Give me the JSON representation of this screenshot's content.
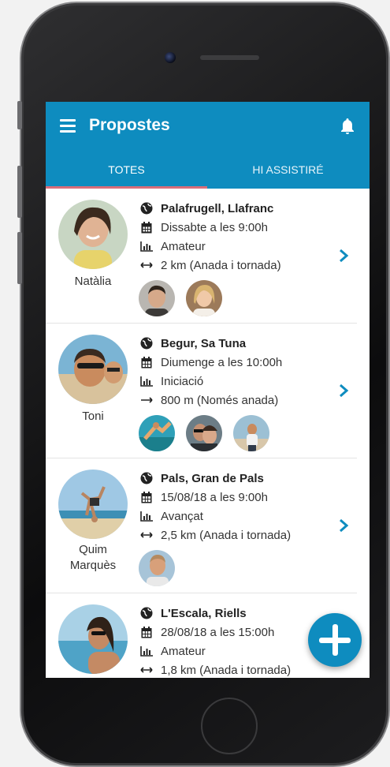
{
  "colors": {
    "accent": "#0e8cbf",
    "tab_indicator": "#d96d7a"
  },
  "appbar": {
    "title": "Propostes",
    "menu_icon": "hamburger-icon",
    "notification_icon": "bell-icon"
  },
  "tabs": [
    {
      "label": "TOTES",
      "selected": true
    },
    {
      "label": "HI ASSISTIRÉ",
      "selected": false
    }
  ],
  "proposals": [
    {
      "name": "Natàlia",
      "place": "Palafrugell, Llafranc",
      "date": "Dissabte a les 9:00h",
      "level": "Amateur",
      "distance": "2 km (Anada i tornada)",
      "attendees": 2
    },
    {
      "name": "Toni",
      "place": "Begur, Sa Tuna",
      "date": "Diumenge a les 10:00h",
      "level": "Iniciació",
      "distance": "800 m (Només anada)",
      "attendees": 3
    },
    {
      "name": "Quim Marquès",
      "place": "Pals, Gran de Pals",
      "date": "15/08/18 a les 9:00h",
      "level": "Avançat",
      "distance": "2,5 km (Anada i tornada)",
      "attendees": 1
    },
    {
      "name": "",
      "place": "L'Escala, Riells",
      "date": "28/08/18 a les 15:00h",
      "level": "Amateur",
      "distance": "1,8 km (Anada i tornada)",
      "attendees": 0
    }
  ],
  "fab": {
    "icon": "plus-icon"
  }
}
